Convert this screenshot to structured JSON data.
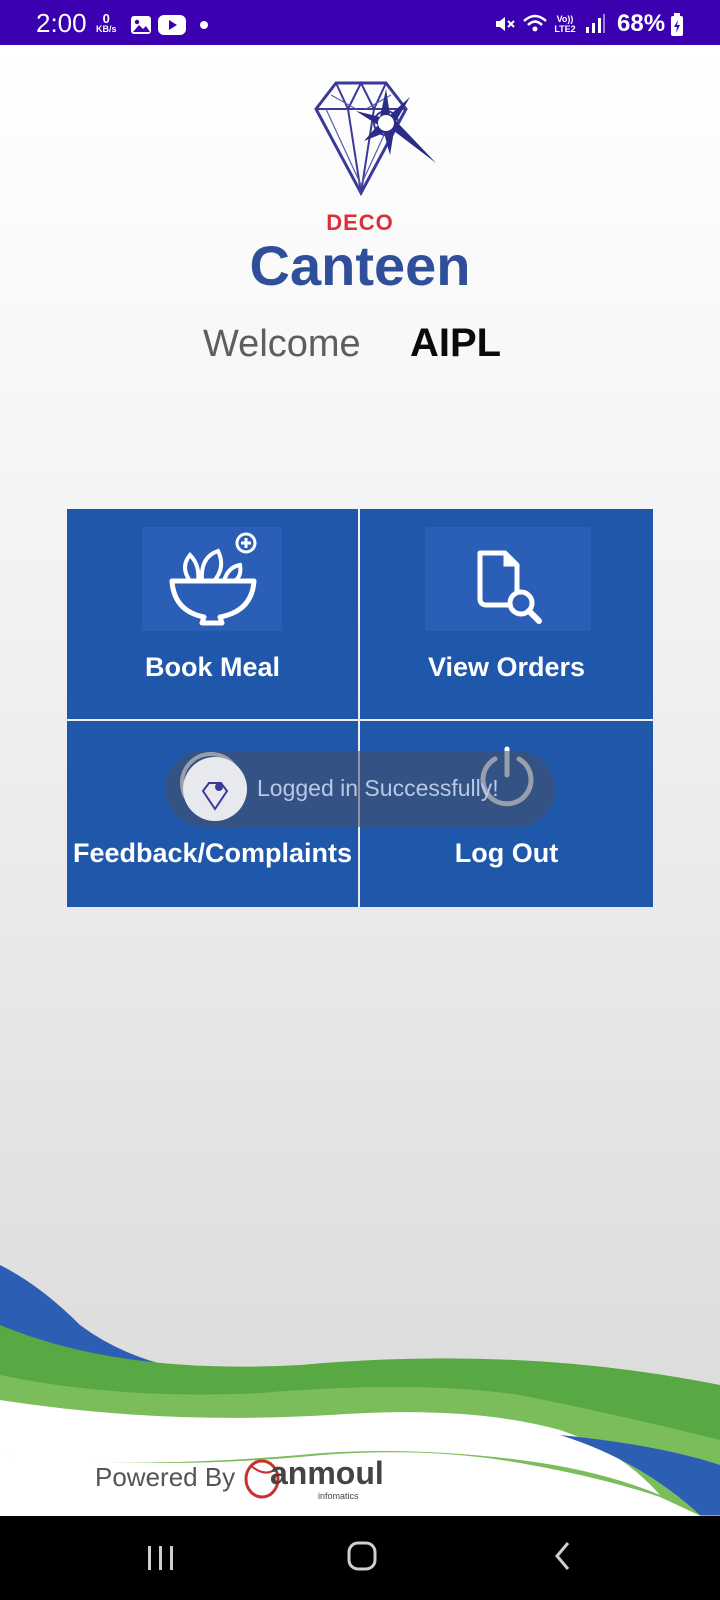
{
  "status_bar": {
    "time": "2:00",
    "net_speed_value": "0",
    "net_speed_unit": "KB/s",
    "lte_label": "Vo)) LTE2",
    "battery_percent": "68%",
    "icons": [
      "gallery-icon",
      "youtube-icon",
      "dot-icon",
      "mute-icon",
      "wifi-icon",
      "signal-icon",
      "battery-icon"
    ]
  },
  "header": {
    "logo": "deco-diamond-logo",
    "brand_small": "DECO",
    "title": "Canteen"
  },
  "welcome": {
    "label": "Welcome",
    "username": "AIPL"
  },
  "menu": {
    "book_meal": {
      "label": "Book Meal",
      "icon": "salad-bowl-icon"
    },
    "view_orders": {
      "label": "View Orders",
      "icon": "document-search-icon"
    },
    "feedback": {
      "label": "Feedback/Complaints",
      "icon": "question-icon"
    },
    "logout": {
      "label": "Log Out",
      "icon": "power-icon"
    }
  },
  "toast": {
    "message": "Logged in Successfully!"
  },
  "footer": {
    "powered_by": "Powered By",
    "brand": "anmoul",
    "brand_sub": "infomatics"
  },
  "colors": {
    "status_bar": "#3b00b0",
    "tile": "#1f57ab",
    "title_blue": "#2f4f9a",
    "deco_red": "#d8313a",
    "wave_blue": "#2c5fb3",
    "wave_green": "#58a843"
  },
  "nav_bar": {
    "icons": [
      "recent-apps-icon",
      "home-icon",
      "back-icon"
    ]
  }
}
